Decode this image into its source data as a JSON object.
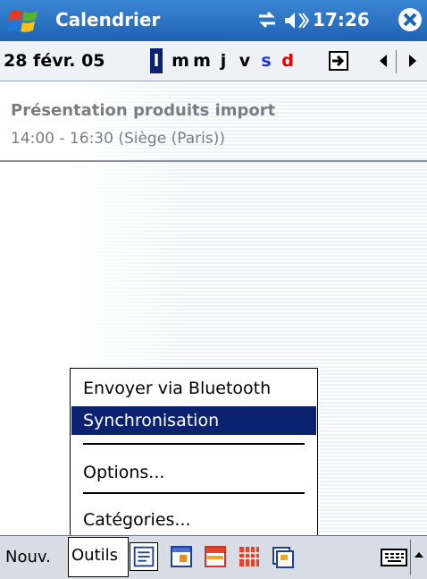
{
  "titlebar": {
    "title": "Calendrier",
    "time": "17:26",
    "icons": [
      "windows-flag-icon",
      "sync-icon",
      "speaker-icon",
      "close-icon"
    ]
  },
  "datebar": {
    "date": "28 févr. 05",
    "weekdays": [
      {
        "label": "l",
        "state": "selected"
      },
      {
        "label": "m",
        "state": "normal"
      },
      {
        "label": "m",
        "state": "normal"
      },
      {
        "label": "j",
        "state": "normal"
      },
      {
        "label": "v",
        "state": "normal"
      },
      {
        "label": "s",
        "state": "saturday"
      },
      {
        "label": "d",
        "state": "sunday"
      }
    ]
  },
  "appointment": {
    "title": "Présentation produits import",
    "detail": "14:00 - 16:30  (Siège (Paris))"
  },
  "menu": {
    "items": [
      {
        "label": "Envoyer via Bluetooth",
        "highlighted": false
      },
      {
        "label": "Synchronisation",
        "highlighted": true
      },
      {
        "label": "Options...",
        "highlighted": false
      },
      {
        "label": "Catégories...",
        "highlighted": false
      }
    ]
  },
  "cmdbar": {
    "new_label": "Nouv.",
    "tools_label": "Outils",
    "views": [
      "agenda-view-icon",
      "day-view-icon",
      "week-view-icon",
      "month-view-icon",
      "year-view-icon"
    ],
    "active_view": "agenda-view-icon"
  },
  "colors": {
    "titlebar": "#1f63b3",
    "highlight": "#0a2270",
    "saturday": "#2433d8",
    "sunday": "#e00000"
  }
}
